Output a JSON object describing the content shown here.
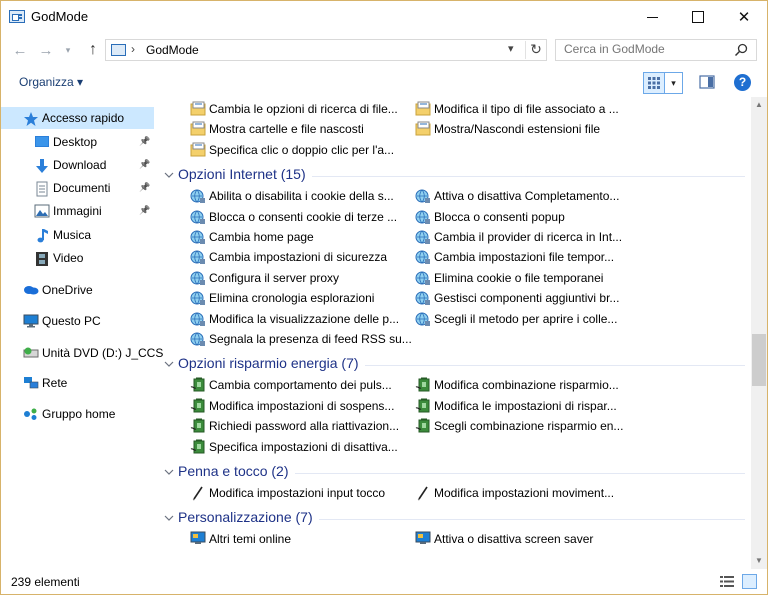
{
  "window": {
    "title": "GodMode"
  },
  "address": {
    "path": "GodMode",
    "separator": "›"
  },
  "search": {
    "placeholder": "Cerca in GodMode"
  },
  "toolbar": {
    "organize_label": "Organizza ▾"
  },
  "nav_pane": {
    "items": [
      {
        "label": "Accesso rapido",
        "icon": "star-icon",
        "selected": true
      },
      {
        "label": "Desktop",
        "icon": "desktop-folder-icon",
        "pinned": true
      },
      {
        "label": "Download",
        "icon": "download-arrow-icon",
        "pinned": true
      },
      {
        "label": "Documenti",
        "icon": "documents-icon",
        "pinned": true
      },
      {
        "label": "Immagini",
        "icon": "pictures-icon",
        "pinned": true
      },
      {
        "label": "Musica",
        "icon": "music-note-icon"
      },
      {
        "label": "Video",
        "icon": "video-film-icon"
      },
      {
        "label": "OneDrive",
        "icon": "onedrive-cloud-icon"
      },
      {
        "label": "Questo PC",
        "icon": "computer-icon"
      },
      {
        "label": "Unità DVD (D:) J_CCS",
        "icon": "dvd-drive-icon"
      },
      {
        "label": "Rete",
        "icon": "network-icon"
      },
      {
        "label": "Gruppo home",
        "icon": "homegroup-icon"
      }
    ]
  },
  "groups": [
    {
      "title": "",
      "partial": true,
      "icon": "folder-options-icon",
      "left": [
        "Cambia le opzioni di ricerca di file...",
        "Mostra cartelle e file nascosti",
        "Specifica clic o doppio clic per l'a..."
      ],
      "right": [
        "Modifica il tipo di file associato a ...",
        "Mostra/Nascondi estensioni file"
      ]
    },
    {
      "title": "Opzioni Internet (15)",
      "icon": "internet-options-icon",
      "left": [
        "Abilita o disabilita i cookie della s...",
        "Blocca o consenti cookie di terze ...",
        "Cambia home page",
        "Cambia impostazioni di sicurezza",
        "Configura il server proxy",
        "Elimina cronologia esplorazioni",
        "Modifica la visualizzazione delle p...",
        "Segnala la presenza di feed RSS su..."
      ],
      "right": [
        "Attiva o disattiva Completamento...",
        "Blocca o consenti popup",
        "Cambia il provider di ricerca in Int...",
        "Cambia impostazioni file tempor...",
        "Elimina cookie o file temporanei",
        "Gestisci componenti aggiuntivi br...",
        "Scegli il metodo per aprire i colle..."
      ]
    },
    {
      "title": "Opzioni risparmio energia (7)",
      "icon": "power-options-icon",
      "left": [
        "Cambia comportamento dei puls...",
        "Modifica impostazioni di sospens...",
        "Richiedi password alla riattivazion...",
        "Specifica impostazioni di disattiva..."
      ],
      "right": [
        "Modifica combinazione risparmio...",
        "Modifica le impostazioni di rispar...",
        "Scegli combinazione risparmio en..."
      ]
    },
    {
      "title": "Penna e tocco (2)",
      "icon": "pen-icon",
      "left": [
        "Modifica impostazioni input tocco"
      ],
      "right": [
        "Modifica impostazioni moviment..."
      ]
    },
    {
      "title": "Personalizzazione (7)",
      "icon": "personalization-icon",
      "left": [
        "Altri temi online"
      ],
      "right": [
        "Attiva o disattiva screen saver"
      ]
    }
  ],
  "status": {
    "count_text": "239 elementi"
  }
}
